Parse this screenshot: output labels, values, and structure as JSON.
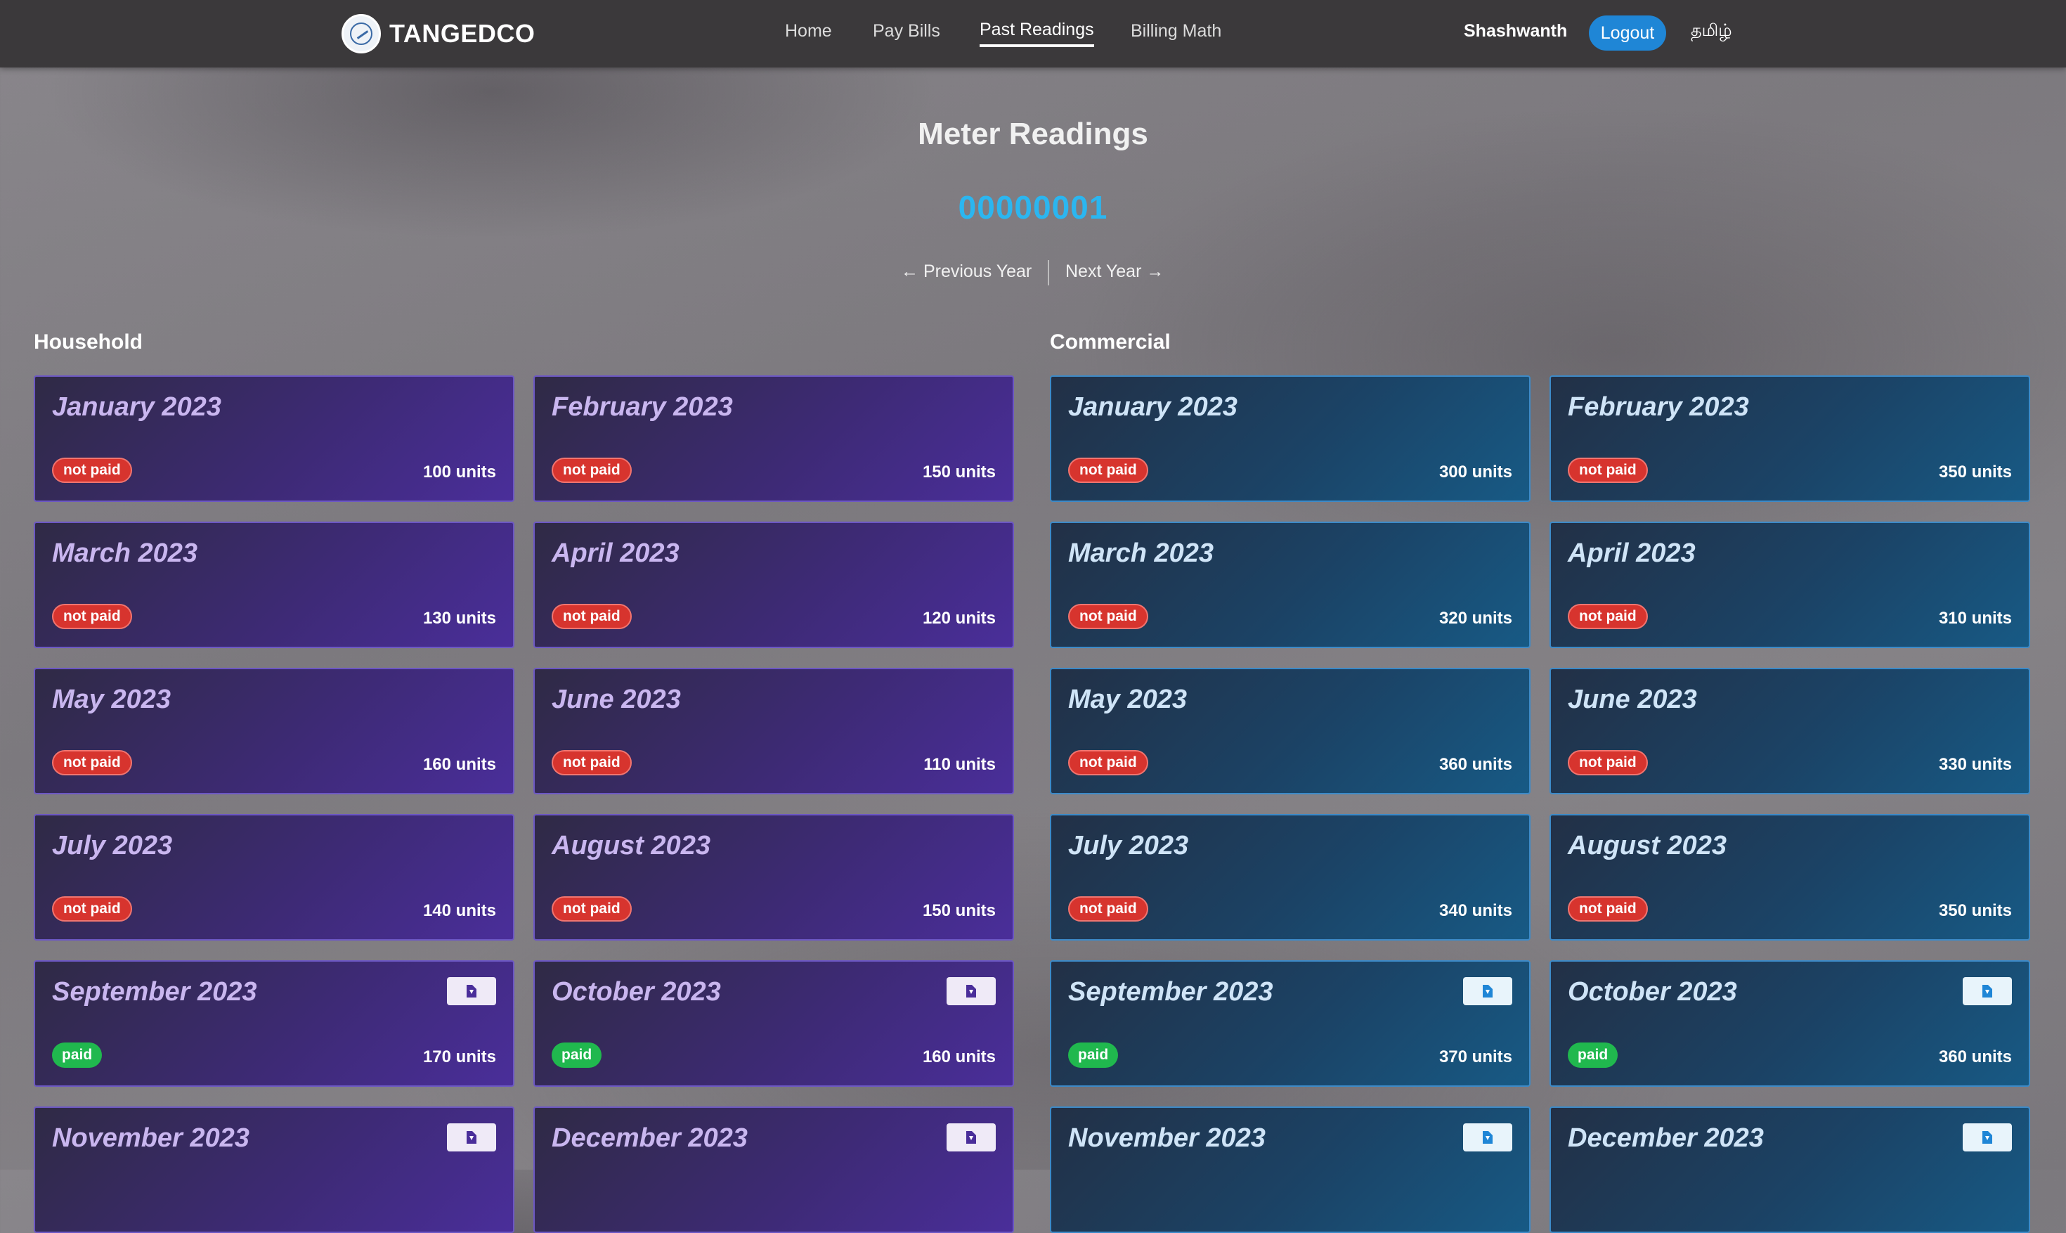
{
  "navbar": {
    "brand": "TANGEDCO",
    "links": [
      {
        "label": "Home",
        "active": false
      },
      {
        "label": "Pay Bills",
        "active": false
      },
      {
        "label": "Past Readings",
        "active": true
      },
      {
        "label": "Billing Math",
        "active": false
      }
    ],
    "user": "Shashwanth",
    "logout_label": "Logout",
    "language_label": "தமிழ்"
  },
  "page": {
    "title": "Meter Readings",
    "meter_id": "00000001",
    "prev_year_label": "← Previous Year",
    "next_year_label": "Next Year →"
  },
  "household": {
    "title": "Household",
    "cards": [
      {
        "month": "January 2023",
        "status": "not paid",
        "units": "100 units",
        "download": false
      },
      {
        "month": "February 2023",
        "status": "not paid",
        "units": "150 units",
        "download": false
      },
      {
        "month": "March 2023",
        "status": "not paid",
        "units": "130 units",
        "download": false
      },
      {
        "month": "April 2023",
        "status": "not paid",
        "units": "120 units",
        "download": false
      },
      {
        "month": "May 2023",
        "status": "not paid",
        "units": "160 units",
        "download": false
      },
      {
        "month": "June 2023",
        "status": "not paid",
        "units": "110 units",
        "download": false
      },
      {
        "month": "July 2023",
        "status": "not paid",
        "units": "140 units",
        "download": false
      },
      {
        "month": "August 2023",
        "status": "not paid",
        "units": "150 units",
        "download": false
      },
      {
        "month": "September 2023",
        "status": "paid",
        "units": "170 units",
        "download": true
      },
      {
        "month": "October 2023",
        "status": "paid",
        "units": "160 units",
        "download": true
      },
      {
        "month": "November 2023",
        "status": "",
        "units": "",
        "download": true
      },
      {
        "month": "December 2023",
        "status": "",
        "units": "",
        "download": true
      }
    ]
  },
  "commercial": {
    "title": "Commercial",
    "cards": [
      {
        "month": "January 2023",
        "status": "not paid",
        "units": "300 units",
        "download": false
      },
      {
        "month": "February 2023",
        "status": "not paid",
        "units": "350 units",
        "download": false
      },
      {
        "month": "March 2023",
        "status": "not paid",
        "units": "320 units",
        "download": false
      },
      {
        "month": "April 2023",
        "status": "not paid",
        "units": "310 units",
        "download": false
      },
      {
        "month": "May 2023",
        "status": "not paid",
        "units": "360 units",
        "download": false
      },
      {
        "month": "June 2023",
        "status": "not paid",
        "units": "330 units",
        "download": false
      },
      {
        "month": "July 2023",
        "status": "not paid",
        "units": "340 units",
        "download": false
      },
      {
        "month": "August 2023",
        "status": "not paid",
        "units": "350 units",
        "download": false
      },
      {
        "month": "September 2023",
        "status": "paid",
        "units": "370 units",
        "download": true
      },
      {
        "month": "October 2023",
        "status": "paid",
        "units": "360 units",
        "download": true
      },
      {
        "month": "November 2023",
        "status": "",
        "units": "",
        "download": true
      },
      {
        "month": "December 2023",
        "status": "",
        "units": "",
        "download": true
      }
    ]
  },
  "colors": {
    "accent": "#1f86d6",
    "meter_id": "#2bb6f0",
    "not_paid": "#d7342e",
    "paid": "#20b84e"
  }
}
